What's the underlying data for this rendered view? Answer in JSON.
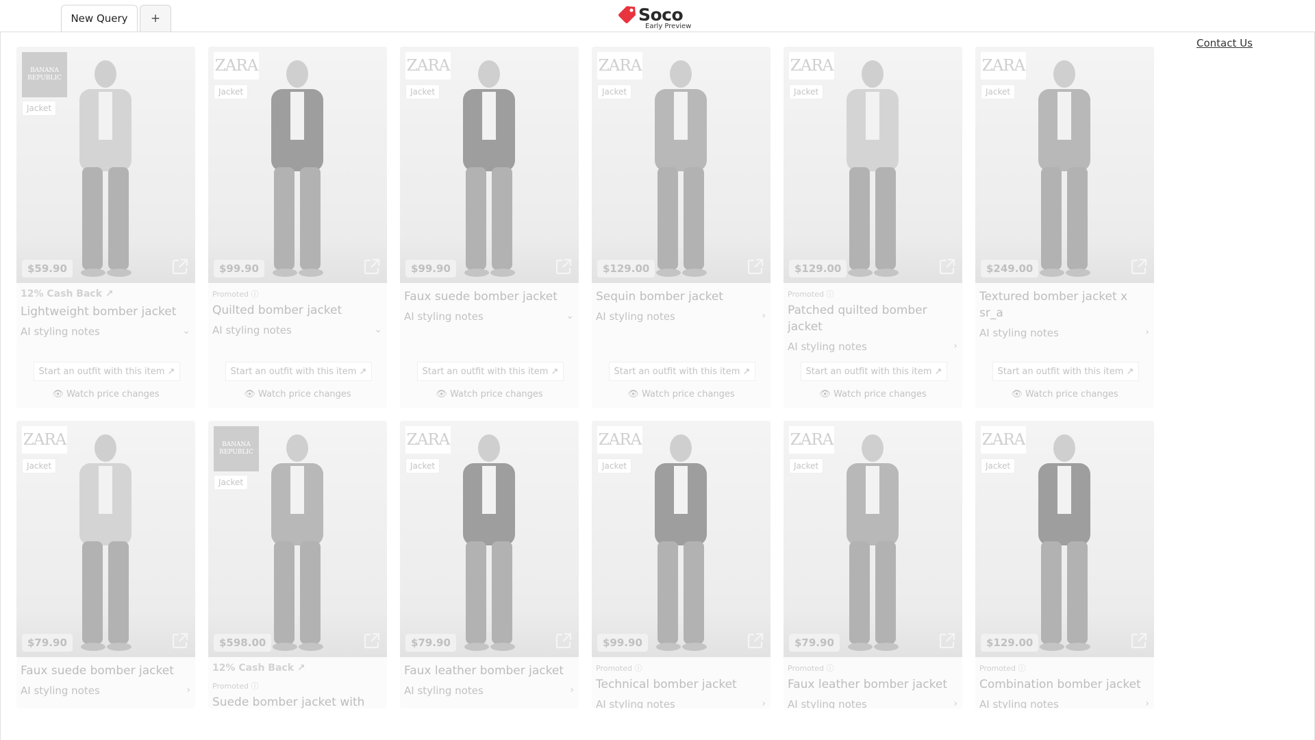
{
  "tabs": {
    "active": "New Query",
    "add": "+"
  },
  "logo": {
    "name": "Soco",
    "subtitle": "Early Preview"
  },
  "contact": "Contact Us",
  "common": {
    "ai_label": "AI styling notes",
    "outfit_label": "Start an outfit with this item",
    "watch_label": "Watch price changes"
  },
  "products": [
    {
      "brand": "BANANA REPUBLIC",
      "category": "Jacket",
      "price": "$59.90",
      "cash_back": "12% Cash Back",
      "promoted": "",
      "title": "Lightweight bomber jacket",
      "expanded": true,
      "tone": "light"
    },
    {
      "brand": "ZARA",
      "category": "Jacket",
      "price": "$99.90",
      "cash_back": "",
      "promoted": "Promoted",
      "title": "Quilted bomber jacket",
      "expanded": true,
      "tone": "dark"
    },
    {
      "brand": "ZARA",
      "category": "Jacket",
      "price": "$99.90",
      "cash_back": "",
      "promoted": "",
      "title": "Faux suede bomber jacket",
      "expanded": true,
      "tone": "dark"
    },
    {
      "brand": "ZARA",
      "category": "Jacket",
      "price": "$129.00",
      "cash_back": "",
      "promoted": "",
      "title": "Sequin bomber jacket",
      "expanded": false,
      "tone": "mid"
    },
    {
      "brand": "ZARA",
      "category": "Jacket",
      "price": "$129.00",
      "cash_back": "",
      "promoted": "Promoted",
      "title": "Patched quilted bomber jacket",
      "expanded": false,
      "tone": "light"
    },
    {
      "brand": "ZARA",
      "category": "Jacket",
      "price": "$249.00",
      "cash_back": "",
      "promoted": "",
      "title": "Textured bomber jacket x sr_a",
      "expanded": false,
      "tone": "mid"
    },
    {
      "brand": "ZARA",
      "category": "Jacket",
      "price": "$79.90",
      "cash_back": "",
      "promoted": "",
      "title": "Faux suede bomber jacket",
      "expanded": false,
      "tone": "light"
    },
    {
      "brand": "BANANA REPUBLIC",
      "category": "Jacket",
      "price": "$598.00",
      "cash_back": "12% Cash Back",
      "promoted": "Promoted",
      "title": "Suede bomber jacket with quilted lining",
      "expanded": false,
      "tone": "mid"
    },
    {
      "brand": "ZARA",
      "category": "Jacket",
      "price": "$79.90",
      "cash_back": "",
      "promoted": "",
      "title": "Faux leather bomber jacket",
      "expanded": false,
      "tone": "dark"
    },
    {
      "brand": "ZARA",
      "category": "Jacket",
      "price": "$99.90",
      "cash_back": "",
      "promoted": "Promoted",
      "title": "Technical bomber jacket",
      "expanded": false,
      "tone": "dark"
    },
    {
      "brand": "ZARA",
      "category": "Jacket",
      "price": "$79.90",
      "cash_back": "",
      "promoted": "Promoted",
      "title": "Faux leather bomber jacket",
      "expanded": false,
      "tone": "mid"
    },
    {
      "brand": "ZARA",
      "category": "Jacket",
      "price": "$129.00",
      "cash_back": "",
      "promoted": "Promoted",
      "title": "Combination bomber jacket",
      "expanded": false,
      "tone": "dark"
    }
  ]
}
